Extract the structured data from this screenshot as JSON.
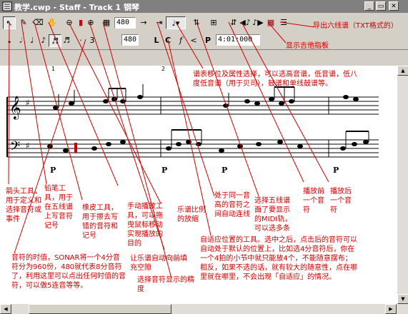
{
  "window": {
    "title": "教学.cwp - Staff - Track 1 钢琴",
    "buttons": [
      "minimize",
      "restore",
      "close"
    ]
  },
  "toolbar": {
    "snap_value": "480",
    "duration_value": "480",
    "time_value": "4:01:000",
    "tools": [
      "arrow",
      "pencil",
      "eraser",
      "scrub"
    ],
    "note_durations": [
      "whole",
      "half",
      "quarter",
      "eighth",
      "sixteenth",
      "thirty-second"
    ],
    "dynamics": [
      "L",
      "C",
      "f",
      "<",
      "P"
    ]
  },
  "ruler": {
    "measure_marks": [
      "1",
      "2"
    ]
  },
  "staff": {
    "pedal_markings": [
      "P",
      "P",
      "P",
      "P",
      "P"
    ]
  },
  "annotations": {
    "six_line_export": "导出六线谱（TXT格式的）",
    "guitar_chords": "显示吉他指板",
    "pitch_transpose": "谱表移位及属性选择，可以选高音谱，低音谱，低八度低音谱（用于贝司），鼓谱和单线鼓谱等。",
    "arrow_tool": "箭头工具，用于定义和选择音符或事件",
    "pencil_tool": "铅笔工具，用于在五线谱上写音符记号",
    "eraser_tool": "橡皮工具，用于擦去写错的音符和记号",
    "scrub_tool": "手动播放工具，可以拖曳鼠标移动实现播放的目的",
    "zoom": "乐谱比例的放缩",
    "same_pitch": "处于同一音高的音符之间自动连线",
    "midi_channel": "选择五线谱面了要显示的MIDI轨，可以选多条",
    "play_prev": "播放前一个音符",
    "play_next": "播放后一个音符",
    "note_length": "音符的时值，SONAR将一个4分音符分为960份，480就代表8分音符了，利用这里可以点出任何时值的音符，可以做5连音等等。",
    "auto_fill": "让乐谱自动向前填充空隙",
    "choose_display": "选择音符显示的精度",
    "auto_position": "自适应位置的工具。选中之后，点击后的音符可以自动处于默认的位置上，比如选4分音符后，你在一个4拍的小节中就只能放4个，不能随意摆布；相反，如果不选的话，就有较大的随意性，点在哪里就在哪里，不会出现「自适应」的情况。"
  },
  "colors": {
    "annotation_red": "#d00000",
    "title_bg": "#808080",
    "face": "#d4d0c8"
  }
}
